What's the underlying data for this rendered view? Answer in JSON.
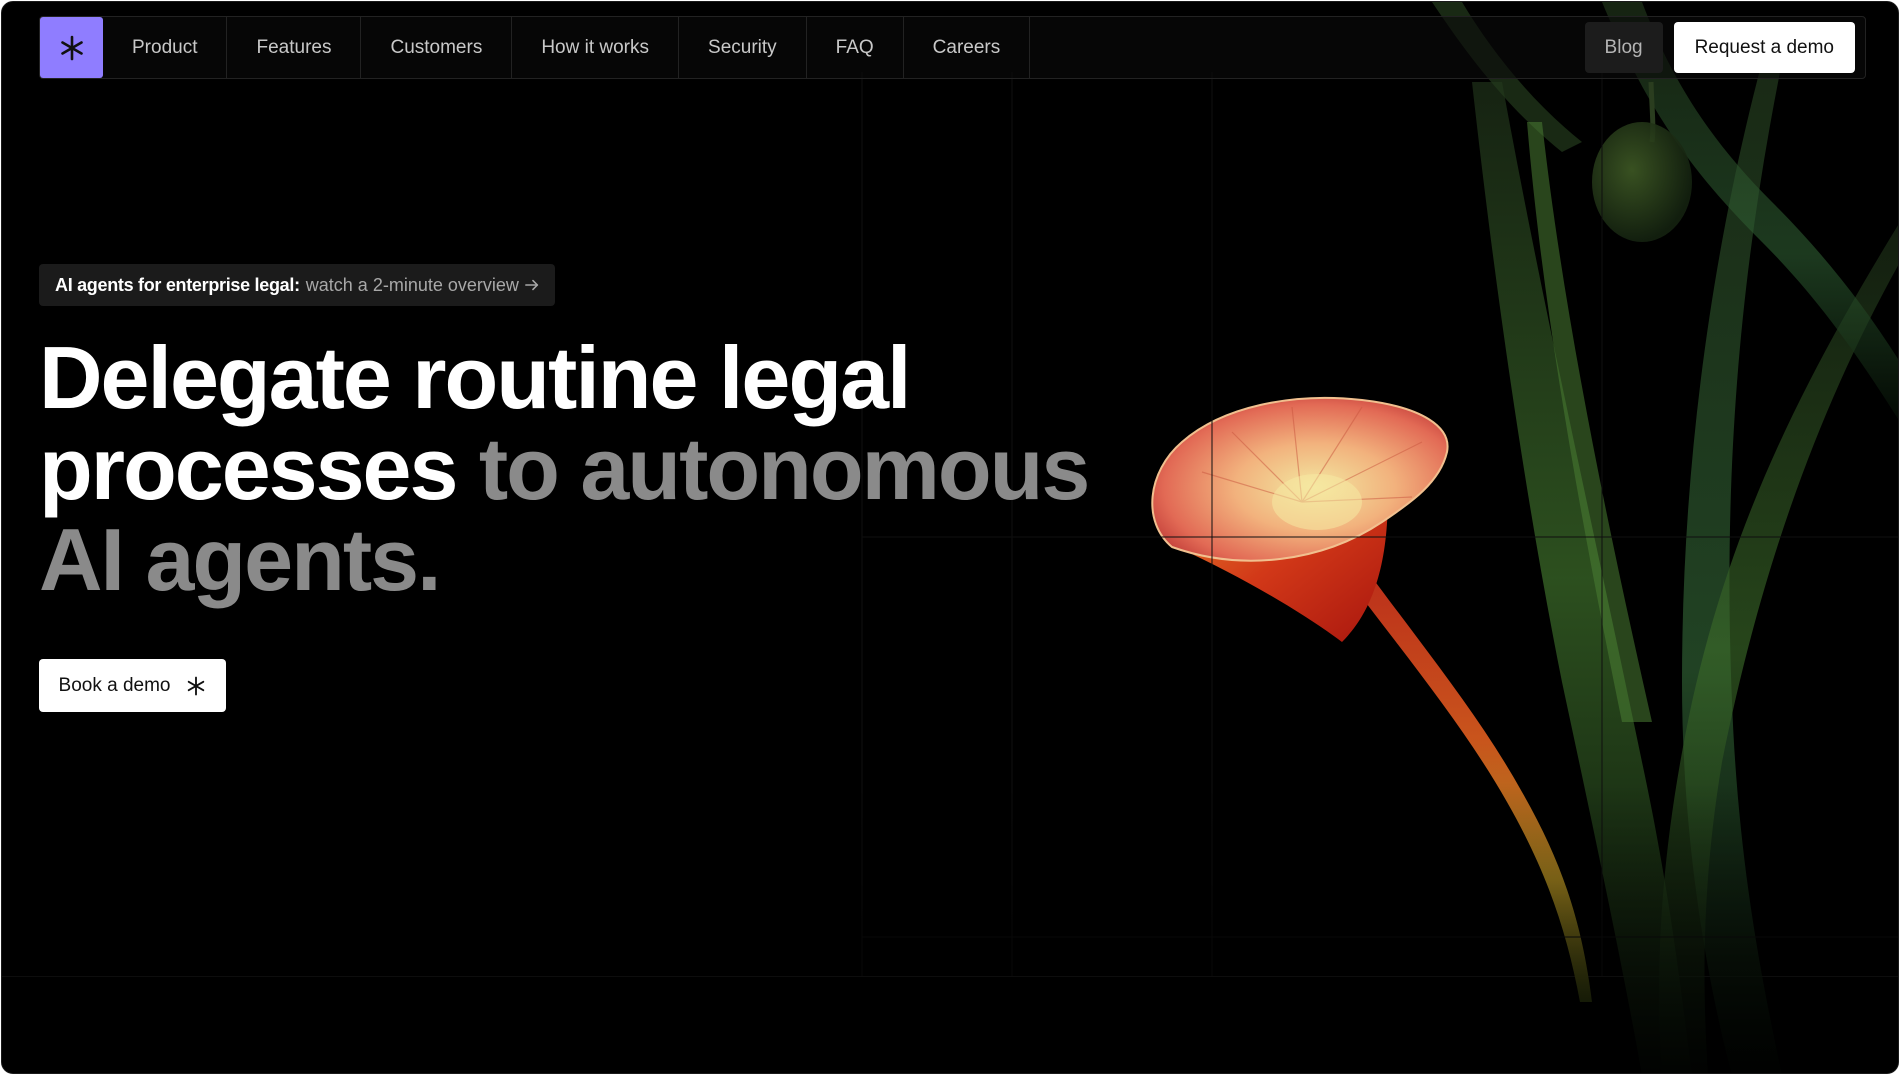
{
  "nav": {
    "logo_icon": "asterisk-icon",
    "items": [
      "Product",
      "Features",
      "Customers",
      "How it works",
      "Security",
      "FAQ",
      "Careers"
    ],
    "blog_label": "Blog",
    "request_demo_label": "Request a demo"
  },
  "hero": {
    "announcement_strong": "AI agents for enterprise legal:",
    "announcement_link": "watch a 2-minute overview",
    "announcement_icon": "arrow-right-icon",
    "headline_primary": "Delegate routine legal processes",
    "headline_secondary": "to autonomous AI agents.",
    "book_demo_label": "Book a demo",
    "book_demo_icon": "asterisk-icon"
  },
  "colors": {
    "background": "#000000",
    "logo_accent": "#8f7dff",
    "headline_dim": "#8a8a8a",
    "flower_petal": "#e8735a",
    "flower_stem": "#c8201a",
    "leaves": "#3a6b2a"
  }
}
